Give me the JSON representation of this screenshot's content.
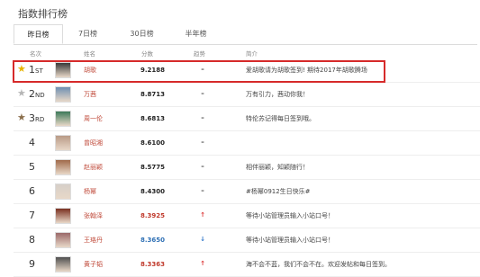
{
  "title": "指数排行榜",
  "tabs": [
    {
      "label": "昨日榜",
      "active": true
    },
    {
      "label": "7日榜",
      "active": false
    },
    {
      "label": "30日榜",
      "active": false
    },
    {
      "label": "半年榜",
      "active": false
    }
  ],
  "columns": {
    "rank": "名次",
    "name": "姓名",
    "score": "分数",
    "trend": "趋势",
    "desc": "简介"
  },
  "colors": {
    "gold_star": "#e8b400",
    "silver_star": "#b5b5b5",
    "bronze_star": "#8a6e4b",
    "name": "#c04a3a",
    "up": "#d33",
    "down": "#2a73c8",
    "score_red": "#c0392b",
    "score_blue": "#2f70b5",
    "highlight": "#d62a2a"
  },
  "rows": [
    {
      "rank": "1",
      "suffix": "ST",
      "star": "gold",
      "avatar": "avatar-hu-ge",
      "name": "胡歌",
      "score": "9.2188",
      "trend": "–",
      "trend_kind": "flat",
      "desc": "爱胡歌请为胡歌签到! 期待2017年胡歌腾场"
    },
    {
      "rank": "2",
      "suffix": "ND",
      "star": "silver",
      "avatar": "avatar-wan-qian",
      "name": "万茜",
      "score": "8.8713",
      "trend": "–",
      "trend_kind": "flat",
      "desc": "万有引力，茜动你我！"
    },
    {
      "rank": "3",
      "suffix": "RD",
      "star": "bronze",
      "avatar": "avatar-zhou-jielun",
      "name": "周一伦",
      "score": "8.6813",
      "trend": "–",
      "trend_kind": "flat",
      "desc": "特伦苏记得每日签到哦。"
    },
    {
      "rank": "4",
      "suffix": "",
      "star": "",
      "avatar": "avatar-zeng-zhaoxiang",
      "name": "曾昭湘",
      "score": "8.6100",
      "trend": "–",
      "trend_kind": "flat",
      "desc": ""
    },
    {
      "rank": "5",
      "suffix": "",
      "star": "",
      "avatar": "avatar-zhao-liying",
      "name": "赵丽颖",
      "score": "8.5775",
      "trend": "–",
      "trend_kind": "flat",
      "desc": "相伴丽颖，知颖随行！"
    },
    {
      "rank": "6",
      "suffix": "",
      "star": "",
      "avatar": "avatar-yang-mi",
      "name": "杨幂",
      "score": "8.4300",
      "trend": "–",
      "trend_kind": "flat",
      "desc": "#杨幂0912生日快乐#"
    },
    {
      "rank": "7",
      "suffix": "",
      "star": "",
      "avatar": "avatar-zhang-hanze",
      "name": "张翰泽",
      "score": "8.3925",
      "trend": "↑",
      "trend_kind": "up",
      "desc": "等待小站管理员输入小站口号！"
    },
    {
      "rank": "8",
      "suffix": "",
      "star": "",
      "avatar": "avatar-wang-luodan",
      "name": "王珞丹",
      "score": "8.3650",
      "trend": "↓",
      "trend_kind": "down",
      "desc": "等待小站管理员输入小站口号！"
    },
    {
      "rank": "9",
      "suffix": "",
      "star": "",
      "avatar": "avatar-huang-zitao",
      "name": "黄子韬",
      "score": "8.3363",
      "trend": "↑",
      "trend_kind": "up",
      "desc": "海不会不蓝，我们不会不在。欢迎发帖和每日签到。"
    }
  ]
}
